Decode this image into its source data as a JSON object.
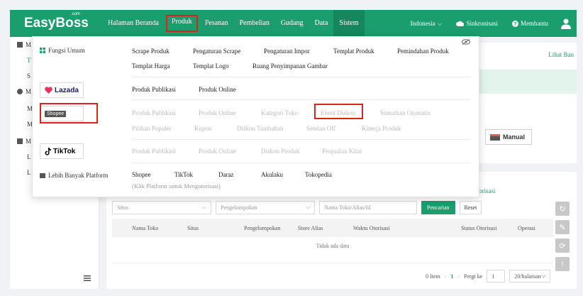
{
  "app": {
    "logo": "EasyBoss",
    "logo_sup": ".com"
  },
  "nav": [
    {
      "label": "Halaman Beranda"
    },
    {
      "label": "Produk"
    },
    {
      "label": "Pesanan"
    },
    {
      "label": "Pembelian"
    },
    {
      "label": "Gudang"
    },
    {
      "label": "Data"
    },
    {
      "label": "Sistem"
    }
  ],
  "topright": {
    "language": "Indonesia",
    "sync": "Sinkronisasi",
    "help": "Membantu"
  },
  "sidebar": {
    "items": [
      {
        "label": "M"
      },
      {
        "label": "T"
      },
      {
        "label": "S"
      },
      {
        "label": "M"
      },
      {
        "label": "M"
      },
      {
        "label": "M"
      },
      {
        "label": "M"
      },
      {
        "label": "L"
      },
      {
        "label": "L"
      }
    ]
  },
  "main": {
    "lihat": "Lihat Ban",
    "manual_btn": "Manual",
    "otorisasi_link": "orisasi",
    "filters": {
      "situs_placeholder": "Situs",
      "pengelompokan_placeholder": "Pengelompokan",
      "search_placeholder": "Nama Toko/Alias/Id",
      "search_btn": "Pencarian",
      "reset_btn": "Reset"
    },
    "table": {
      "headers": [
        "Nama Toko",
        "Situs",
        "Pengelompokan",
        "Store Alias",
        "Waktu Otorisasi",
        "Status Otorisasi",
        "Operasi"
      ],
      "empty": "Tidak ada data"
    },
    "pager": {
      "total": "0 Item",
      "current": "1",
      "goto": "Pergi ke",
      "goto_value": "1",
      "page_size": "20/halaman"
    }
  },
  "dropdown": {
    "platforms": {
      "general": "Fungsi Umum",
      "lazada": "Lazada",
      "shopee": "Shopee",
      "tiktok": "TikTok",
      "more": "Lebih Banyak Platform"
    },
    "general_row1": [
      "Scrape Produk",
      "Pengaturan Scrape",
      "Pengaturan Impor",
      "Templat Produk",
      "Pemindahan Produk"
    ],
    "general_row2": [
      "Templat Harga",
      "Templat Logo",
      "Ruang Penyimpanan Gambar"
    ],
    "lazada_row": [
      "Produk Publikasi",
      "Produk Online"
    ],
    "shopee_row1": [
      "Produk Publikasi",
      "Produk Online",
      "Kategori Toko",
      "Event Diskon",
      "Sematkan Otomatis"
    ],
    "shopee_row2": [
      "Pilihan Populer",
      "Kupon",
      "Diskon Tambahan",
      "Setelan Off",
      "Kinerja Produk"
    ],
    "tiktok_row": [
      "Produk Publikasi",
      "Produk Online",
      "Diskon Produk",
      "Penjualan Kilat"
    ],
    "more_row": [
      "Shopee",
      "TikTok",
      "Daraz",
      "Akulaku",
      "Tokopedia"
    ],
    "more_hint": "(Klik Platform untuk Mengotorisasi)"
  },
  "colors": {
    "brand": "#1a9e6e",
    "highlight": "#e0201b"
  }
}
